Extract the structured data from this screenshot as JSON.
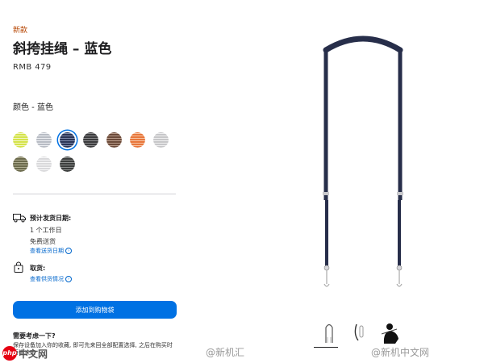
{
  "product": {
    "badge": "新款",
    "title": "斜挎挂绳 – 蓝色",
    "price": "RMB 479",
    "color_label": "颜色 - 蓝色"
  },
  "swatches": [
    {
      "name": "lime",
      "color": "#d4e34a",
      "stripe": "#f3f6c4",
      "selected": false
    },
    {
      "name": "light-gray",
      "color": "#b8bcc4",
      "stripe": "#eceef2",
      "selected": false
    },
    {
      "name": "blue",
      "color": "#2b3556",
      "stripe": "#7d88a8",
      "selected": true
    },
    {
      "name": "charcoal",
      "color": "#3a3a3c",
      "stripe": "#8a8a8c",
      "selected": false
    },
    {
      "name": "brown",
      "color": "#6b4a3a",
      "stripe": "#b89b8a",
      "selected": false
    },
    {
      "name": "orange",
      "color": "#e8763a",
      "stripe": "#f6c3a3",
      "selected": false
    },
    {
      "name": "silver",
      "color": "#c7c7c9",
      "stripe": "#eeeeef",
      "selected": false
    },
    {
      "name": "olive",
      "color": "#6b6a4c",
      "stripe": "#b0ae92",
      "selected": false
    },
    {
      "name": "white",
      "color": "#d9d9db",
      "stripe": "#f7f7f8",
      "selected": false
    },
    {
      "name": "dark-gray",
      "color": "#3b3d3c",
      "stripe": "#8c8e8d",
      "selected": false
    }
  ],
  "shipping": {
    "title": "预计发货日期:",
    "days": "1 个工作日",
    "free": "免费送货",
    "link": "查看送货日期"
  },
  "pickup": {
    "title": "取货:",
    "link": "查看供货情况"
  },
  "cart_button": "添加到购物袋",
  "consider": {
    "title": "需要考虑一下?",
    "text": "保存设备加入你的收藏, 即可先来回全部配置选择, 之后在购买时再做决定"
  },
  "thumbnails": [
    "strap-thumb",
    "clip-thumb",
    "model-thumb"
  ],
  "watermarks": {
    "left": "中文网",
    "left_logo": "php",
    "mid": "@新机汇",
    "right": "@新机中文网"
  },
  "colors": {
    "accent": "#0071e3",
    "link": "#0066cc",
    "badge": "#b64400",
    "strap": "#272e4a"
  }
}
